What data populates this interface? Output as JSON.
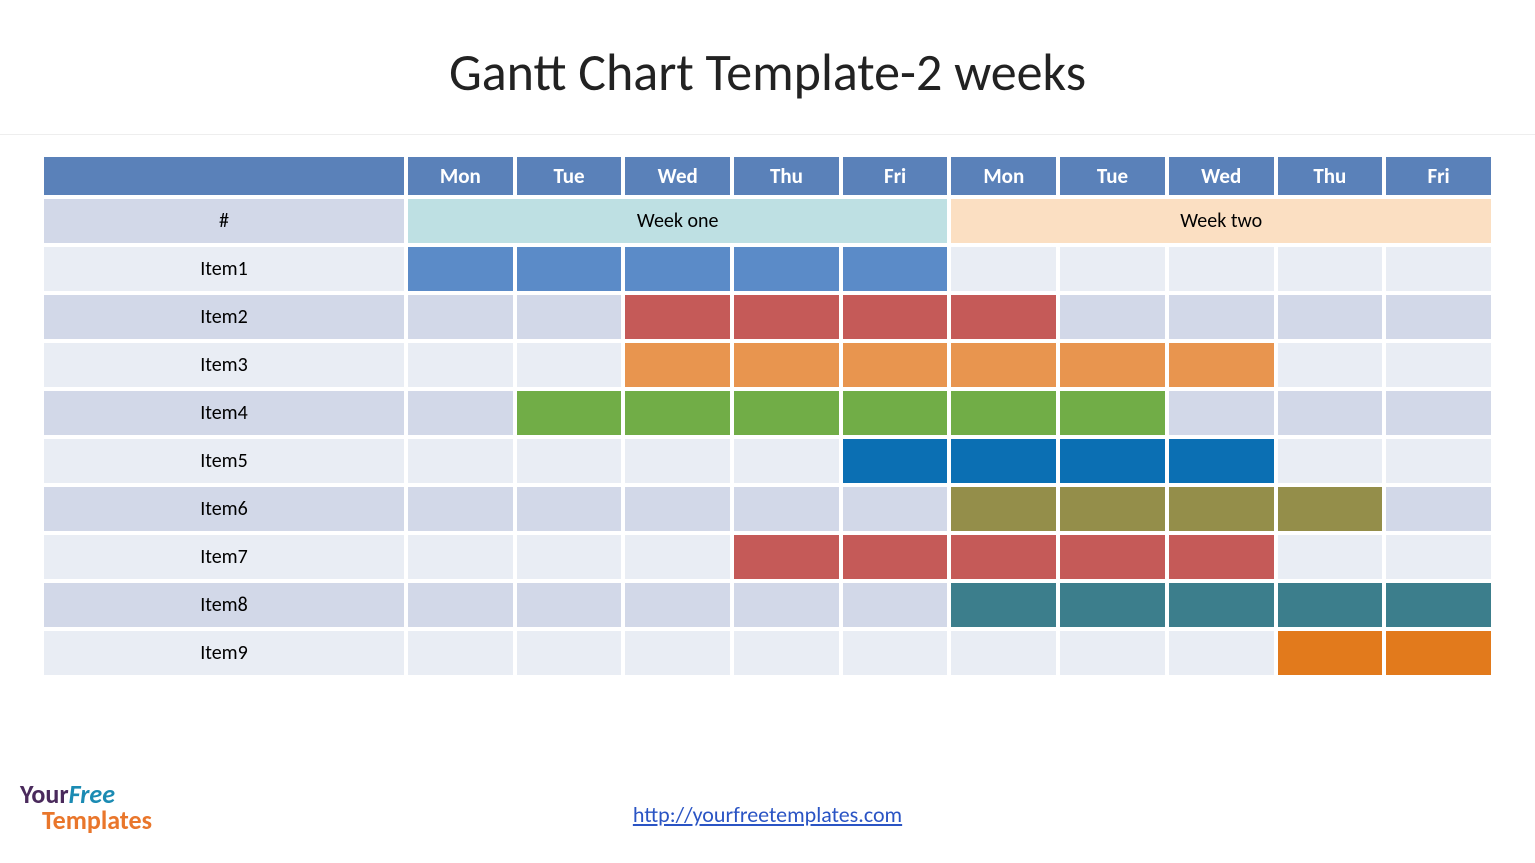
{
  "title": "Gantt Chart Template-2 weeks",
  "link": "http://yourfreetemplates.com",
  "logo": {
    "your": "Your",
    "free": "Free",
    "templates": "Templates"
  },
  "chart_data": {
    "type": "gantt",
    "title": "Gantt Chart Template-2 weeks",
    "days": [
      "Mon",
      "Tue",
      "Wed",
      "Thu",
      "Fri",
      "Mon",
      "Tue",
      "Wed",
      "Thu",
      "Fri"
    ],
    "weeks": [
      {
        "label": "Week one",
        "span": 5,
        "bg": "#bee0e3"
      },
      {
        "label": "Week two",
        "span": 5,
        "bg": "#fbdfc2"
      }
    ],
    "hash": "#",
    "row_bgs": [
      "#e9edf4",
      "#d2d8e8"
    ],
    "items": [
      {
        "name": "Item1",
        "start": 1,
        "end": 5,
        "color": "#5b8bc8"
      },
      {
        "name": "Item2",
        "start": 3,
        "end": 6,
        "color": "#c55a58"
      },
      {
        "name": "Item3",
        "start": 3,
        "end": 8,
        "color": "#e8954f"
      },
      {
        "name": "Item4",
        "start": 2,
        "end": 7,
        "color": "#71ad47"
      },
      {
        "name": "Item5",
        "start": 5,
        "end": 8,
        "color": "#0b6fb3"
      },
      {
        "name": "Item6",
        "start": 6,
        "end": 9,
        "color": "#948e4a"
      },
      {
        "name": "Item7",
        "start": 4,
        "end": 8,
        "color": "#c55a58"
      },
      {
        "name": "Item8",
        "start": 6,
        "end": 10,
        "color": "#3c7e8c"
      },
      {
        "name": "Item9",
        "start": 9,
        "end": 10,
        "color": "#e27a1c"
      }
    ]
  }
}
